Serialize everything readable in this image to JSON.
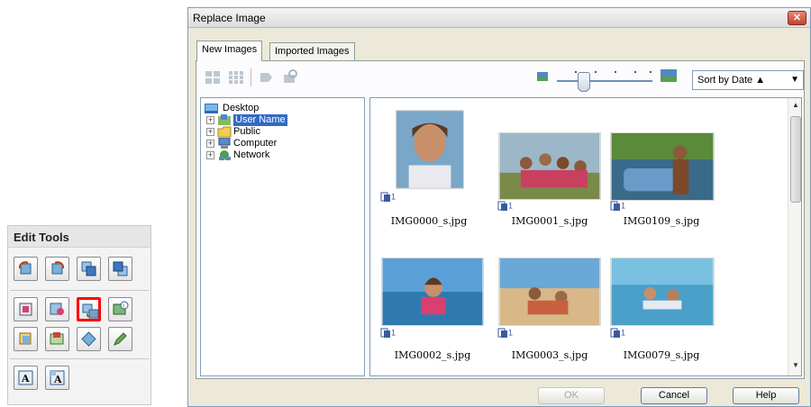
{
  "edit_tools": {
    "title": "Edit Tools",
    "rows": [
      [
        "rotate-left-icon",
        "rotate-right-icon",
        "bring-forward-icon",
        "send-backward-icon"
      ],
      [
        "crop-icon",
        "correct-image-icon",
        "replace-image-icon",
        "properties-icon"
      ],
      [
        "frame-icon",
        "layout-icon",
        "shape-icon",
        "pen-icon"
      ],
      [
        "text-a-icon",
        "text-b-icon"
      ]
    ],
    "highlighted": "replace-image-icon"
  },
  "dialog": {
    "title": "Replace Image",
    "close_label": "✕",
    "tabs": [
      {
        "label": "New Images",
        "active": true
      },
      {
        "label": "Imported Images",
        "active": false
      }
    ],
    "toolbar_icons": [
      "large-thumbnails-icon",
      "small-thumbnails-icon",
      "select-icon",
      "search-icon"
    ],
    "sort": {
      "value": "Sort by Date ▲",
      "arrow": "▼"
    },
    "zoom_level": 0.2,
    "tree": [
      {
        "label": "Desktop",
        "icon": "desktop-icon",
        "expander": "",
        "selected": false
      },
      {
        "label": "User Name",
        "icon": "user-folder-icon",
        "expander": "+",
        "selected": true
      },
      {
        "label": "Public",
        "icon": "folder-icon",
        "expander": "+",
        "selected": false
      },
      {
        "label": "Computer",
        "icon": "computer-icon",
        "expander": "+",
        "selected": false
      },
      {
        "label": "Network",
        "icon": "network-icon",
        "expander": "+",
        "selected": false
      }
    ],
    "thumbnails": [
      {
        "name": "IMG0000_s.jpg",
        "count": "1"
      },
      {
        "name": "IMG0001_s.jpg",
        "count": "1"
      },
      {
        "name": "IMG0109_s.jpg",
        "count": "1"
      },
      {
        "name": "IMG0002_s.jpg",
        "count": "1"
      },
      {
        "name": "IMG0003_s.jpg",
        "count": "1"
      },
      {
        "name": "IMG0079_s.jpg",
        "count": "1"
      }
    ],
    "buttons": {
      "ok": "OK",
      "cancel": "Cancel",
      "help": "Help"
    },
    "scroll_up": "▲",
    "scroll_down": "▼"
  },
  "colors": {
    "highlight": "#ff0000",
    "selection": "#316ac5",
    "dialog_bg": "#ece9d8"
  }
}
